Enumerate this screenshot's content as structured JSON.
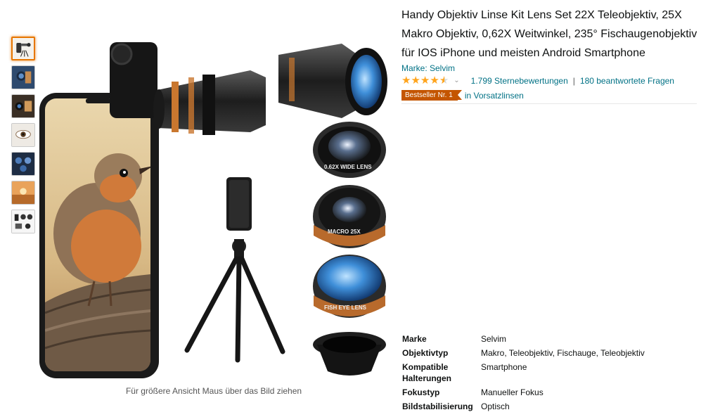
{
  "product": {
    "title": "Handy Objektiv Linse Kit Lens Set 22X Teleobjektiv, 25X Makro Objektiv, 0,62X Weitwinkel, 235° Fischaugenobjektiv für IOS iPhone und meisten Android Smartphone",
    "brand_link": "Marke: Selvim",
    "rating_stars": 4.3,
    "ratings_count": "1.799 Sternebewertungen",
    "answered_questions": "180 beantwortete Fragen",
    "bestseller_badge": "Bestseller Nr. 1",
    "bestseller_category": "in Vorsatzlinsen",
    "zoom_hint": "Für größere Ansicht Maus über das Bild ziehen",
    "lens_labels": {
      "wide": "0.62X WIDE LENS",
      "macro": "MACRO 25X",
      "fisheye": "FISH EYE LENS"
    }
  },
  "thumbnails": [
    {
      "name": "thumb-1",
      "active": true
    },
    {
      "name": "thumb-2",
      "active": false
    },
    {
      "name": "thumb-3",
      "active": false
    },
    {
      "name": "thumb-4",
      "active": false
    },
    {
      "name": "thumb-5",
      "active": false
    },
    {
      "name": "thumb-6",
      "active": false
    },
    {
      "name": "thumb-7",
      "active": false
    }
  ],
  "specs": [
    {
      "key": "Marke",
      "value": "Selvim"
    },
    {
      "key": "Objektivtyp",
      "value": "Makro, Teleobjektiv, Fischauge, Teleobjektiv"
    },
    {
      "key": "Kompatible Halterungen",
      "value": "Smartphone"
    },
    {
      "key": "Fokustyp",
      "value": "Manueller Fokus"
    },
    {
      "key": "Bildstabilisierung",
      "value": "Optisch"
    }
  ],
  "colors": {
    "link": "#007185",
    "star": "#ffa41c",
    "badge": "#c45500",
    "thumb_active_border": "#e77600"
  }
}
